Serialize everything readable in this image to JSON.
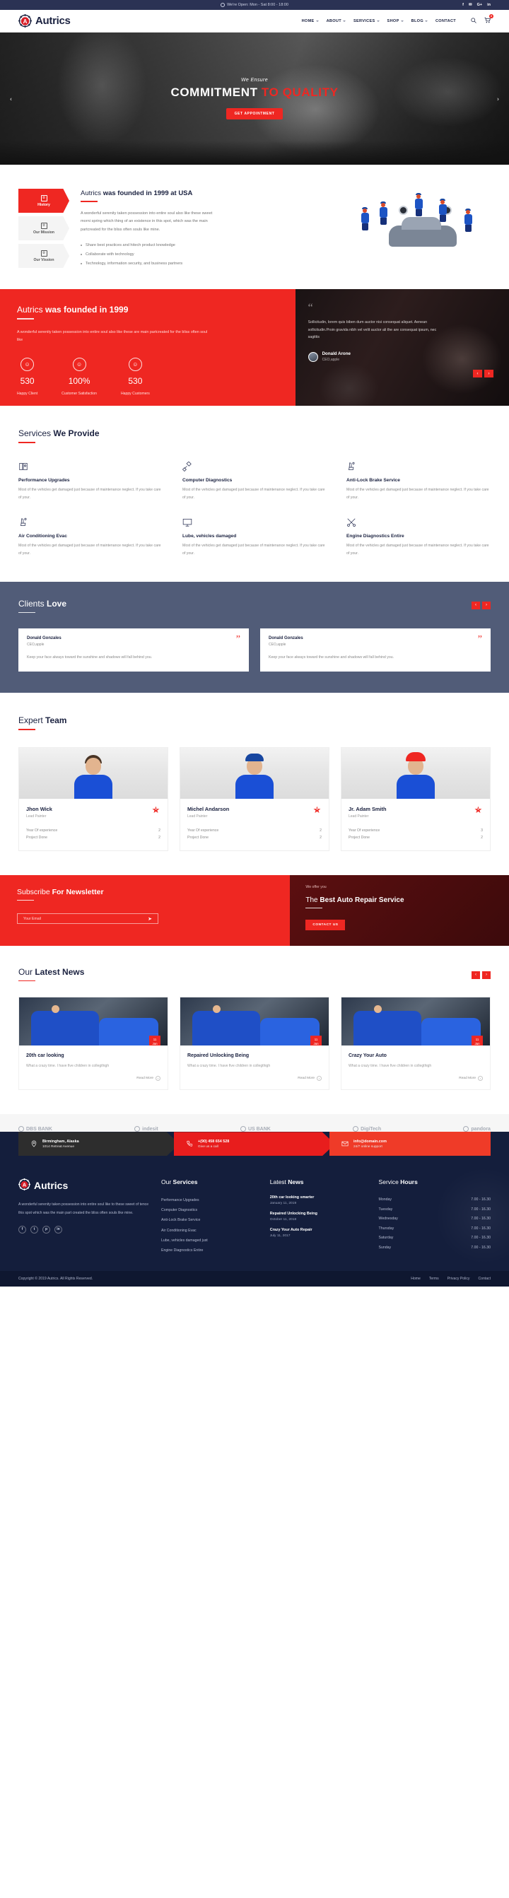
{
  "topbar": {
    "hours": "We're Open: Mon - Sat 8:00 - 18:00",
    "socials": [
      "f",
      "✉",
      "G+",
      "in"
    ]
  },
  "header": {
    "brand": "Autrics",
    "nav": [
      {
        "label": "HOME",
        "caret": true
      },
      {
        "label": "ABOUT",
        "caret": true
      },
      {
        "label": "SERVICES",
        "caret": true
      },
      {
        "label": "SHOP",
        "caret": true
      },
      {
        "label": "BLOG",
        "caret": true
      },
      {
        "label": "CONTACT",
        "caret": false
      }
    ],
    "search_icon": "search-icon",
    "cart_icon": "cart-icon",
    "cart_count": "0"
  },
  "hero": {
    "subtitle": "We Ensure",
    "title_part1": "COMMITMENT ",
    "title_part2": "TO QUALITY",
    "button": "GET APPOINTMENT",
    "prev": "‹",
    "next": "›"
  },
  "about": {
    "tabs": [
      {
        "label": "History",
        "active": true
      },
      {
        "label": "Our Mission",
        "active": false
      },
      {
        "label": "Our Vission",
        "active": false
      }
    ],
    "heading_light": "Autrics ",
    "heading_bold": "was founded in 1999 at USA",
    "paragraph": "A wonderful serenity taken possession into entire soul also like these sweet morni spring which thing of an existence in this spot, which was the main partcreated for the bliss often souls like mine.",
    "bullets": [
      "Share best practices and hitech product knowledge",
      "Collaborate with technology",
      "Technology, information security, and business partners"
    ]
  },
  "stats_section": {
    "heading_light": "Autrics ",
    "heading_bold": "was founded in 1999",
    "paragraph": "A wonderful serenity taken possession into entire soul also like these are main partcreated for the bliss often soul like",
    "stats": [
      {
        "value": "530",
        "label": "Happy Client",
        "icon": "user-icon"
      },
      {
        "value": "100%",
        "label": "Customer Satisfaction",
        "icon": "user-icon"
      },
      {
        "value": "530",
        "label": "Happy Customers",
        "icon": "user-icon"
      }
    ],
    "testimonial": {
      "quote_mark": "“",
      "text": "Sollicitudin, lorem quis biben dum auctor nisi consequat aliquet. Aenean sollicitudin.Proin gravida nibh vel velit auctor ali the are consequat ipsum, nec sagittis",
      "name": "Donald Arone",
      "role": "CEO,apple",
      "prev": "‹",
      "next": "›"
    }
  },
  "services": {
    "heading_light": "Services ",
    "heading_bold": "We Provide",
    "items": [
      {
        "icon": "manual-book-icon",
        "glyph": "☷",
        "title": "Performance Upgrades",
        "text": "Most of the vehicles get damaged just because of maintenance neglect. If you take care of your."
      },
      {
        "icon": "piston-icon",
        "glyph": "⚒",
        "title": "Computer Diagnostics",
        "text": "Most of the vehicles get damaged just because of maintenance neglect. If you take care of your."
      },
      {
        "icon": "car-seat-icon",
        "glyph": "♻",
        "title": "Anti-Lock Brake Service",
        "text": "Most of the vehicles get damaged just because of maintenance neglect. If you take care of your."
      },
      {
        "icon": "car-seat-icon",
        "glyph": "♻",
        "title": "Air Conditioning Evac",
        "text": "Most of the vehicles get damaged just because of maintenance neglect. If you take care of your."
      },
      {
        "icon": "monitor-icon",
        "glyph": "▭",
        "title": "Lube, vehicles damaged",
        "text": "Most of the vehicles get damaged just because of maintenance neglect. If you take care of your."
      },
      {
        "icon": "tools-cross-icon",
        "glyph": "⚔",
        "title": "Engine Diagnostics Entire",
        "text": "Most of the vehicles get damaged just because of maintenance neglect. If you take care of your."
      }
    ]
  },
  "clients": {
    "heading_light": "Clients ",
    "heading_bold": "Love",
    "prev": "‹",
    "next": "›",
    "cards": [
      {
        "name": "Donald Gonzales",
        "role": "CEO,apple",
        "quote_mark": "”",
        "text": "Keep your face always toward the sunshine and shadows will fall behind you."
      },
      {
        "name": "Donald Gonzales",
        "role": "CEO,apple",
        "quote_mark": "”",
        "text": "Keep your face always toward the sunshine and shadows will fall behind you."
      }
    ]
  },
  "team": {
    "heading_light": "Expert ",
    "heading_bold": "Team",
    "members": [
      {
        "name": "Jhon Wick",
        "role": "Lead Painter",
        "rating": "4",
        "headwear": "none",
        "stats": [
          {
            "label": "Year Of experience",
            "value": "2"
          },
          {
            "label": "Project Done",
            "value": "2"
          }
        ]
      },
      {
        "name": "Michel Andarson",
        "role": "Lead Painter",
        "rating": "5",
        "headwear": "cap",
        "stats": [
          {
            "label": "Year Of experience",
            "value": "2"
          },
          {
            "label": "Project Done",
            "value": "2"
          }
        ]
      },
      {
        "name": "Jr. Adam Smith",
        "role": "Lead Painter",
        "rating": "4",
        "headwear": "helmet",
        "stats": [
          {
            "label": "Year Of experience",
            "value": "3"
          },
          {
            "label": "Project Done",
            "value": "2"
          }
        ]
      }
    ]
  },
  "newsletter": {
    "heading_light": "Subscribe ",
    "heading_bold": "For Newsletter",
    "placeholder": "Your Email",
    "value": "",
    "send_icon": "send-icon",
    "offer_label": "We offer you",
    "offer_light": "The ",
    "offer_bold": "Best Auto Repair Service",
    "button": "CONTACT US"
  },
  "news": {
    "heading_light": "Our ",
    "heading_bold": "Latest News",
    "prev": "‹",
    "next": "›",
    "posts": [
      {
        "day": "11",
        "month": "Jan",
        "title": "20th car looking",
        "text": "What a crazy time. I have five children in collegthigh",
        "more": "Read More"
      },
      {
        "day": "11",
        "month": "Jan",
        "title": "Repaired Unlocking Being",
        "text": "What a crazy time. I have five children in collegthigh",
        "more": "Read More"
      },
      {
        "day": "11",
        "month": "Jan",
        "title": "Crazy Your Auto",
        "text": "What a crazy time. I have five children in collegthigh",
        "more": "Read More"
      }
    ]
  },
  "partners": [
    {
      "name": "DBS BANK",
      "icon": "bank-icon"
    },
    {
      "name": "indesit",
      "icon": "circle-icon"
    },
    {
      "name": "US BANK",
      "icon": "circle-icon"
    },
    {
      "name": "DigiTech",
      "icon": "grid-icon"
    },
    {
      "name": "pandora",
      "icon": "circle-icon"
    }
  ],
  "contact_strip": [
    {
      "icon": "location-pin-icon",
      "glyph": "⊙",
      "line1": "Birmingham, Alaska",
      "line2": "1014 Retreat Avenue"
    },
    {
      "icon": "phone-icon",
      "glyph": "☎",
      "line1": "+(90) 458 654 528",
      "line2": "Give us a call"
    },
    {
      "icon": "envelope-icon",
      "glyph": "✉",
      "line1": "info@domain.com",
      "line2": "24/7 online support"
    }
  ],
  "footer": {
    "brand": "Autrics",
    "about": "A wonderful serenity taken possession into entire soul like to these sweet of tence this spot which was the main part created the bliss often souls like mine.",
    "socials": [
      "f",
      "t",
      "p",
      "in"
    ],
    "services_heading_light": "Our ",
    "services_heading_bold": "Services",
    "services": [
      "Performance Upgrades",
      "Computer Diagnostics",
      "Anti-Lock Brake Service",
      "Air Conditioning Evac",
      "Lube, vehicles damaged just",
      "Engine Diagnostics Entire"
    ],
    "news_heading_light": "Latest ",
    "news_heading_bold": "News",
    "news": [
      {
        "title": "20th car looking smarter",
        "date": "January 11, 2019"
      },
      {
        "title": "Repaired Unlocking Being",
        "date": "October 11, 2018"
      },
      {
        "title": "Crazy Your Auto Repair",
        "date": "July 11, 2017"
      }
    ],
    "hours_heading_light": "Service ",
    "hours_heading_bold": "Hours",
    "hours": [
      {
        "day": "Monday",
        "time": "7.00 - 16.30"
      },
      {
        "day": "Tuesday",
        "time": "7.00 - 16.30"
      },
      {
        "day": "Wednesday",
        "time": "7.00 - 16.30"
      },
      {
        "day": "Thursday",
        "time": "7.00 - 16.30"
      },
      {
        "day": "Saturday",
        "time": "7.00 - 16.30"
      },
      {
        "day": "Sunday",
        "time": "7.00 - 16.30"
      }
    ]
  },
  "copybar": {
    "text": "Copyright © 2019 Autrics. All Rights Reserved.",
    "links": [
      "Home",
      "Terms",
      "Privacy Policy",
      "Contact"
    ]
  },
  "colors": {
    "red": "#ef2722",
    "navy": "#2b3254",
    "footer_navy": "#141e3c",
    "slate": "#515c78"
  }
}
